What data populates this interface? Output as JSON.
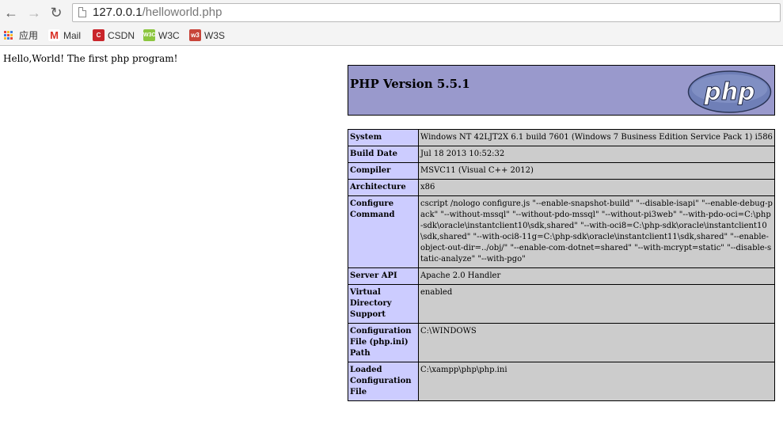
{
  "browser": {
    "url_host": "127.0.0.1",
    "url_path": "/helloworld.php",
    "bookmarks": [
      {
        "label": "应用",
        "icon": "apps-grid-icon"
      },
      {
        "label": "Mail",
        "icon": "gmail-icon",
        "color": "#d93025"
      },
      {
        "label": "CSDN",
        "icon": "csdn-icon",
        "color": "#c9252b"
      },
      {
        "label": "W3C",
        "icon": "w3c-icon",
        "color": "#8cc63f"
      },
      {
        "label": "W3S",
        "icon": "w3s-icon",
        "color": "#c8443a"
      }
    ]
  },
  "page": {
    "hello": "Hello,World! The first php program!"
  },
  "phpinfo": {
    "version": "PHP Version 5.5.1",
    "logo_text": "php",
    "rows": [
      {
        "key": "System",
        "value": "Windows NT 42LJT2X 6.1 build 7601 (Windows 7 Business Edition Service Pack 1) i586"
      },
      {
        "key": "Build Date",
        "value": "Jul 18 2013 10:52:32"
      },
      {
        "key": "Compiler",
        "value": "MSVC11 (Visual C++ 2012)"
      },
      {
        "key": "Architecture",
        "value": "x86"
      },
      {
        "key": "Configure Command",
        "value": "cscript /nologo configure.js \"--enable-snapshot-build\" \"--disable-isapi\" \"--enable-debug-pack\" \"--without-mssql\" \"--without-pdo-mssql\" \"--without-pi3web\" \"--with-pdo-oci=C:\\php-sdk\\oracle\\instantclient10\\sdk,shared\" \"--with-oci8=C:\\php-sdk\\oracle\\instantclient10\\sdk,shared\" \"--with-oci8-11g=C:\\php-sdk\\oracle\\instantclient11\\sdk,shared\" \"--enable-object-out-dir=../obj/\" \"--enable-com-dotnet=shared\" \"--with-mcrypt=static\" \"--disable-static-analyze\" \"--with-pgo\""
      },
      {
        "key": "Server API",
        "value": "Apache 2.0 Handler"
      },
      {
        "key": "Virtual Directory Support",
        "value": "enabled"
      },
      {
        "key": "Configuration File (php.ini) Path",
        "value": "C:\\WINDOWS"
      },
      {
        "key": "Loaded Configuration File",
        "value": "C:\\xampp\\php\\php.ini"
      }
    ]
  }
}
